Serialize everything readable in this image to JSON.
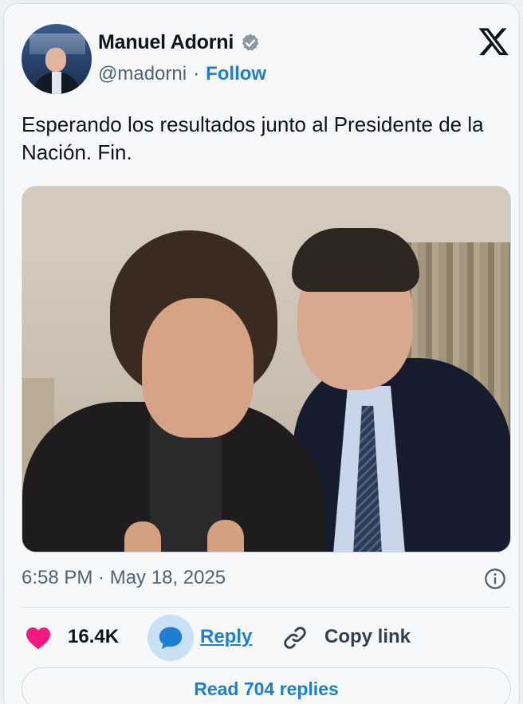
{
  "author": {
    "name": "Manuel Adorni",
    "handle": "@madorni",
    "separator": "·",
    "follow_label": "Follow",
    "verified_icon": "verified-badge-icon"
  },
  "tweet": {
    "text": "Esperando los resultados junto al Presidente de la Nación. Fin.",
    "timestamp": "6:58 PM · May 18, 2025"
  },
  "actions": {
    "likes": "16.4K",
    "reply_label": "Reply",
    "copy_link_label": "Copy link"
  },
  "read_replies_label": "Read 704 replies",
  "colors": {
    "accent": "#1d7ed4",
    "heart": "#f91880",
    "verified": "#8b98a5"
  }
}
